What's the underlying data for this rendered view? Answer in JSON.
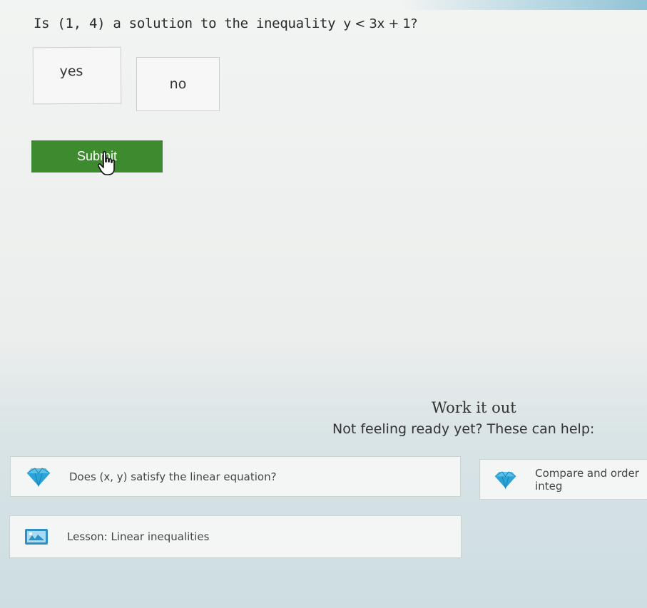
{
  "question": {
    "prefix": "Is",
    "point": "(1, 4)",
    "middle": "a solution to the inequality",
    "inequality": "y < 3x + 1",
    "suffix": "?"
  },
  "choices": [
    {
      "label": "yes"
    },
    {
      "label": "no"
    }
  ],
  "submit_label": "Submit",
  "help": {
    "heading": "Work it out",
    "subheading": "Not feeling ready yet? These can help:",
    "cards": [
      {
        "label": "Does (x, y) satisfy the linear equation?",
        "icon": "diamond-icon"
      },
      {
        "label": "Compare and order integ",
        "icon": "diamond-icon"
      },
      {
        "label": "Lesson: Linear inequalities",
        "icon": "lesson-icon"
      }
    ]
  },
  "colors": {
    "submit_green": "#3d8a2f",
    "diamond_blue": "#2aa3d8"
  }
}
